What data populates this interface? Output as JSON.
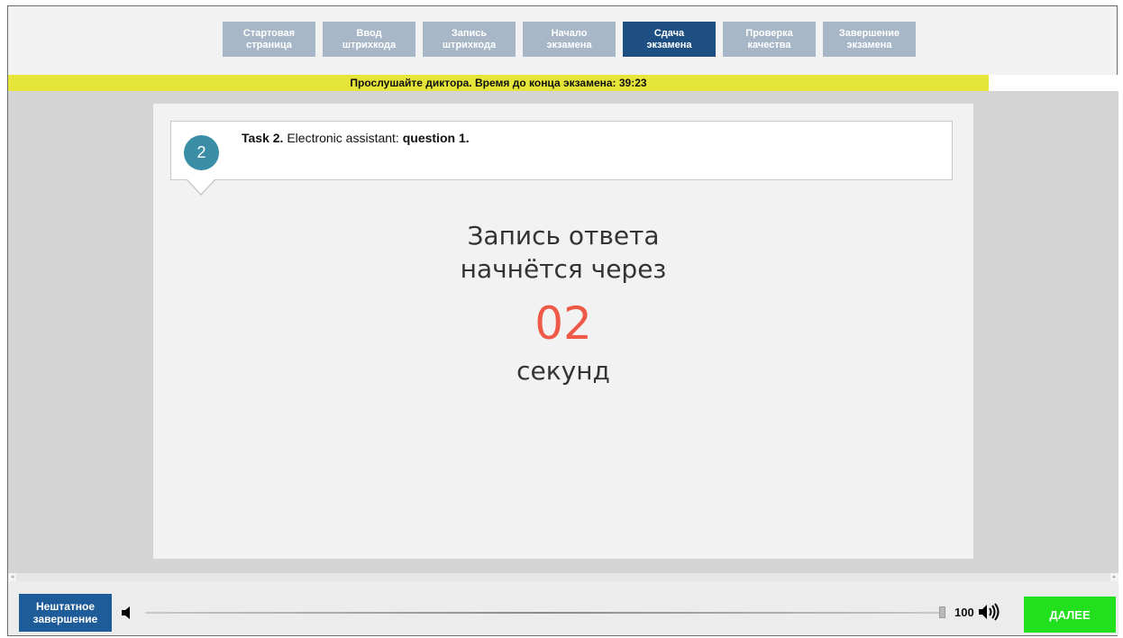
{
  "nav": {
    "steps": [
      {
        "line1": "Стартовая",
        "line2": "страница"
      },
      {
        "line1": "Ввод",
        "line2": "штрихкода"
      },
      {
        "line1": "Запись",
        "line2": "штрихкода"
      },
      {
        "line1": "Начало",
        "line2": "экзамена"
      },
      {
        "line1": "Сдача",
        "line2": "экзамена"
      },
      {
        "line1": "Проверка",
        "line2": "качества"
      },
      {
        "line1": "Завершение",
        "line2": "экзамена"
      }
    ],
    "active_index": 4
  },
  "status": {
    "text": "Прослушайте диктора. Время до конца экзамена: 39:23"
  },
  "task": {
    "number": "2",
    "label": "Task 2.",
    "description": "Electronic assistant:",
    "question": "question 1."
  },
  "countdown": {
    "line1": "Запись ответа",
    "line2": "начнётся через",
    "value": "02",
    "unit": "секунд"
  },
  "footer": {
    "abort_line1": "Нештатное",
    "abort_line2": "завершение",
    "volume_value": "100",
    "volume_level": 1.0,
    "next_label": "ДАЛЕЕ"
  },
  "colors": {
    "step_inactive": "#a7b7c7",
    "step_active": "#1e4f82",
    "status_bar": "#e6e63a",
    "countdown_number": "#ee5a47",
    "task_circle": "#3a8ea6",
    "next_button": "#22e01e",
    "abort_button": "#1e5b99"
  }
}
